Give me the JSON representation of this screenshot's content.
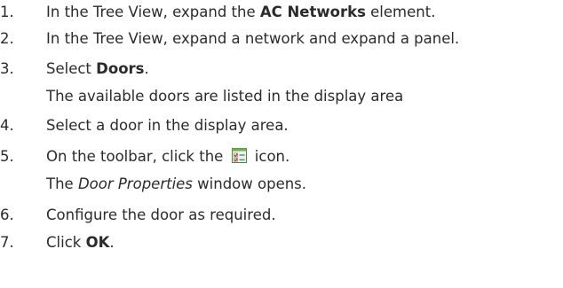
{
  "steps": [
    {
      "num": "1.",
      "pre": "In the Tree View, expand the ",
      "bold": "AC Networks",
      "post": " element."
    },
    {
      "num": "2.",
      "text": "In the Tree View, expand a network and expand a panel."
    },
    {
      "num": "3.",
      "pre": "Select ",
      "bold": "Doors",
      "post": "."
    },
    {
      "sub": "The available doors are listed in the display area"
    },
    {
      "num": "4.",
      "text": "Select a door in the display area."
    },
    {
      "num": "5.",
      "pre": "On the toolbar, click the ",
      "icon": "door-properties-icon",
      "post": " icon."
    },
    {
      "sub_pre": "The ",
      "sub_italic": "Door Properties",
      "sub_post": " window opens."
    },
    {
      "num": "6.",
      "text": "Configure the door as required."
    },
    {
      "num": "7.",
      "pre": "Click ",
      "bold": "OK",
      "post": "."
    }
  ],
  "colors": {
    "text": "#2b2b2b",
    "icon_border": "#4a8a3a",
    "icon_check": "#d9342b"
  }
}
